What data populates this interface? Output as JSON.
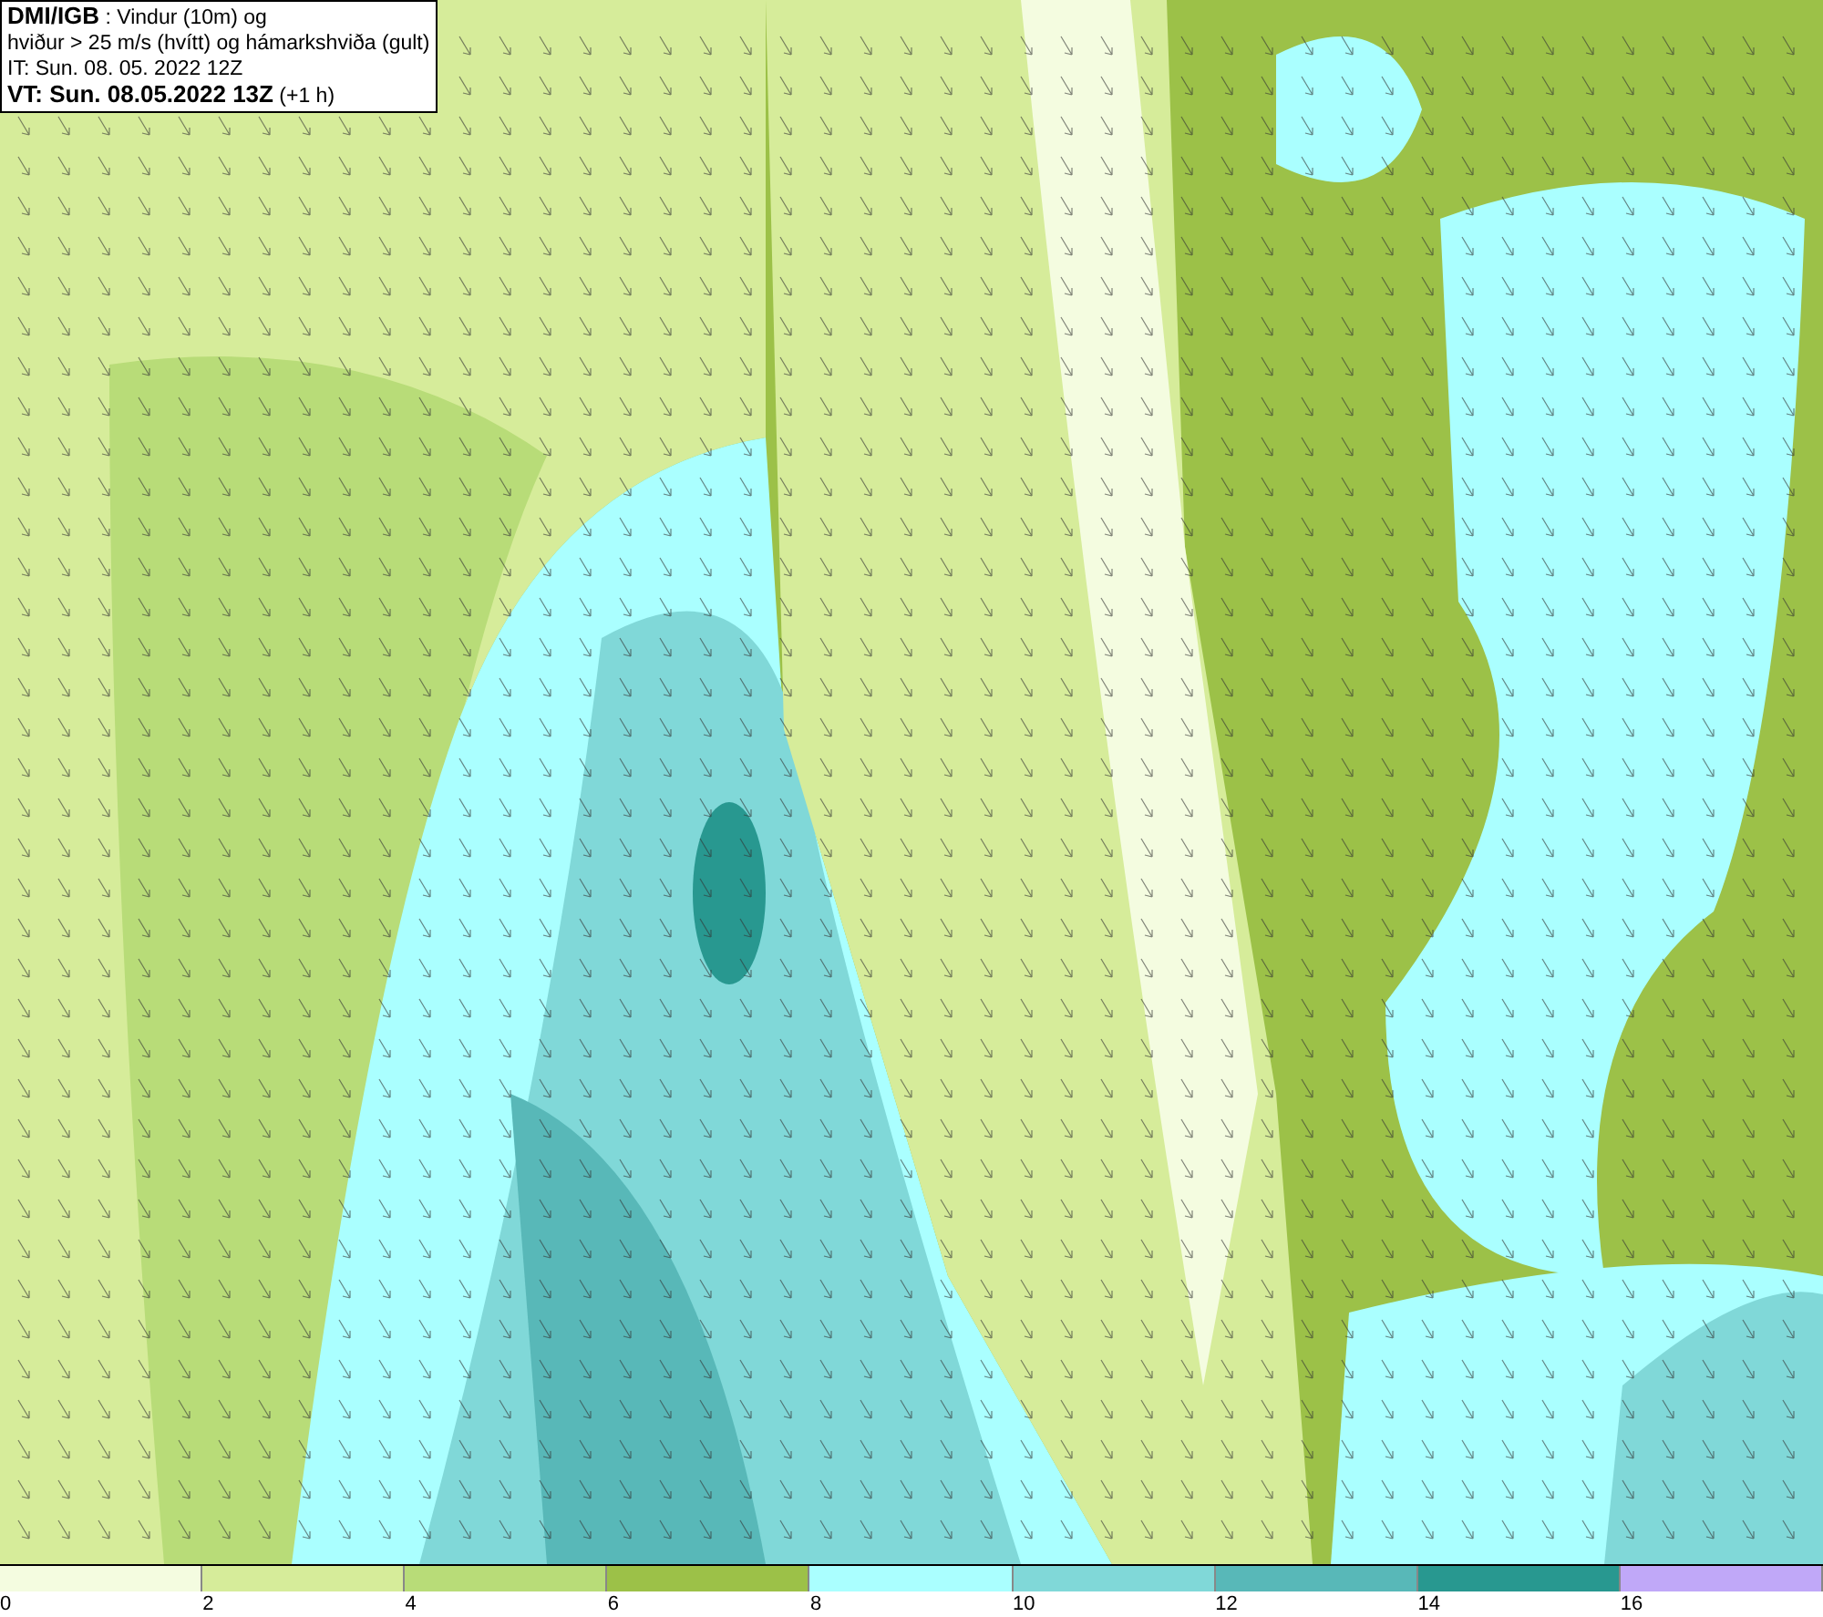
{
  "header": {
    "lines": [
      "**DMI/IGB** : Vindur (10m) og",
      "hviður > 25 m/s (hvítt) og hámarkshviða (gult)",
      "IT: Sun. 08. 05. 2022 12Z",
      "**VT: Sun. 08.05.2022 13Z** (+1 h)"
    ]
  },
  "legend": {
    "bins": [
      {
        "color": "#f4fce0"
      },
      {
        "color": "#d6ec9a"
      },
      {
        "color": "#b8dc78"
      },
      {
        "color": "#9cc148"
      },
      {
        "color": "#aaffff"
      },
      {
        "color": "#80d8d8"
      },
      {
        "color": "#58b8b8"
      },
      {
        "color": "#289890"
      },
      {
        "color": "#c0a8f8"
      }
    ],
    "ticks": [
      "0",
      "2",
      "4",
      "6",
      "8",
      "10",
      "12",
      "14",
      "16"
    ]
  }
}
